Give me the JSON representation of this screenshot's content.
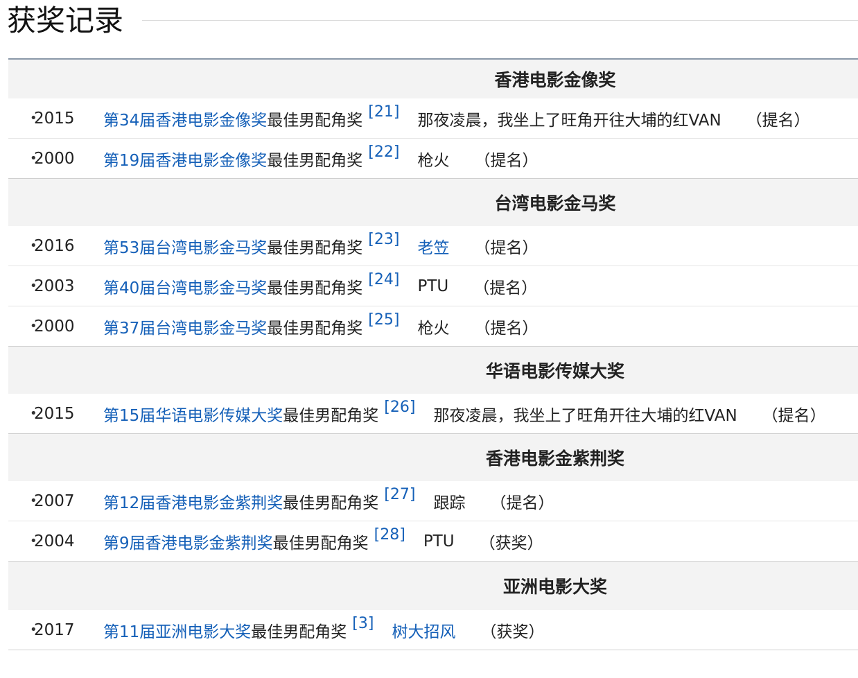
{
  "page_title": "获奖记录",
  "sections": [
    {
      "title": "香港电影金像奖",
      "rows": [
        {
          "year": "2015",
          "award_link": "第34届香港电影金像奖",
          "award_tail": "最佳男配角奖",
          "ref": "[21]",
          "film": "那夜凌晨，我坐上了旺角开往大埔的红VAN",
          "film_is_link": false,
          "result": "（提名）"
        },
        {
          "year": "2000",
          "award_link": "第19届香港电影金像奖",
          "award_tail": "最佳男配角奖",
          "ref": "[22]",
          "film": "枪火",
          "film_is_link": false,
          "result": "（提名）"
        }
      ]
    },
    {
      "title": "台湾电影金马奖",
      "rows": [
        {
          "year": "2016",
          "award_link": "第53届台湾电影金马奖",
          "award_tail": "最佳男配角奖",
          "ref": "[23]",
          "film": "老笠",
          "film_is_link": true,
          "result": "（提名）"
        },
        {
          "year": "2003",
          "award_link": "第40届台湾电影金马奖",
          "award_tail": "最佳男配角奖",
          "ref": "[24]",
          "film": "PTU",
          "film_is_link": false,
          "result": "（提名）"
        },
        {
          "year": "2000",
          "award_link": "第37届台湾电影金马奖",
          "award_tail": "最佳男配角奖",
          "ref": "[25]",
          "film": "枪火",
          "film_is_link": false,
          "result": "（提名）"
        }
      ]
    },
    {
      "title": "华语电影传媒大奖",
      "rows": [
        {
          "year": "2015",
          "award_link": "第15届华语电影传媒大奖",
          "award_tail": "最佳男配角奖",
          "ref": "[26]",
          "film": "那夜凌晨，我坐上了旺角开往大埔的红VAN",
          "film_is_link": false,
          "result": "（提名）"
        }
      ]
    },
    {
      "title": "香港电影金紫荆奖",
      "rows": [
        {
          "year": "2007",
          "award_link": "第12届香港电影金紫荆奖",
          "award_tail": "最佳男配角奖",
          "ref": "[27]",
          "film": "跟踪",
          "film_is_link": false,
          "result": "（提名）"
        },
        {
          "year": "2004",
          "award_link": "第9届香港电影金紫荆奖",
          "award_tail": "最佳男配角奖",
          "ref": "[28]",
          "film": "PTU",
          "film_is_link": false,
          "result": "（获奖）"
        }
      ]
    },
    {
      "title": "亚洲电影大奖",
      "rows": [
        {
          "year": "2017",
          "award_link": "第11届亚洲电影大奖",
          "award_tail": "最佳男配角奖",
          "ref": "[3]",
          "film": "树大招风",
          "film_is_link": true,
          "result": "（获奖）"
        }
      ]
    }
  ]
}
